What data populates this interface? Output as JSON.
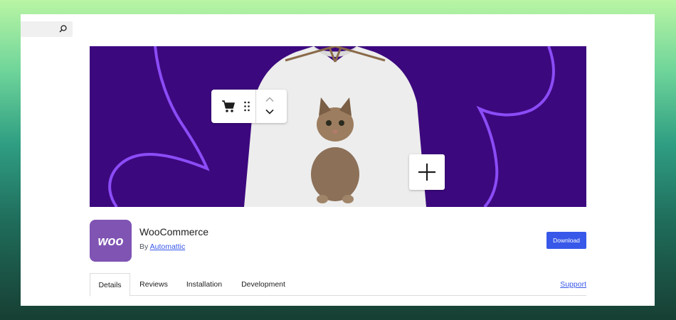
{
  "search": {
    "icon": "search-icon"
  },
  "banner": {
    "background": "#3c087e",
    "accent": "#8b4cf7",
    "toolbar_icons": [
      "cart-icon",
      "drag-handle-icon",
      "chevron-up-icon",
      "chevron-down-icon"
    ],
    "add_icon": "plus-icon"
  },
  "plugin": {
    "logo_text": "woo",
    "logo_color": "#7f54b3",
    "name": "WooCommerce",
    "by_prefix": "By",
    "author": "Automattic",
    "download_label": "Download",
    "download_color": "#3858e9"
  },
  "tabs": [
    {
      "label": "Details",
      "active": true
    },
    {
      "label": "Reviews",
      "active": false
    },
    {
      "label": "Installation",
      "active": false
    },
    {
      "label": "Development",
      "active": false
    }
  ],
  "support_label": "Support"
}
